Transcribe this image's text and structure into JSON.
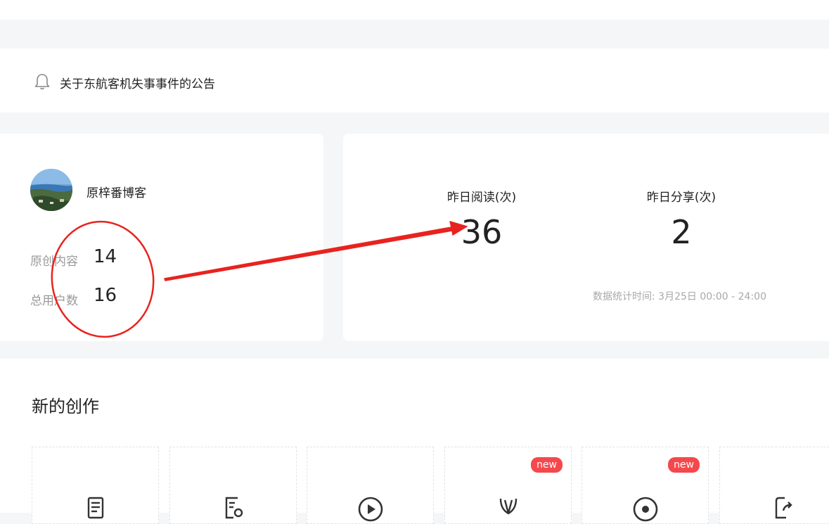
{
  "notice": {
    "text": "关于东航客机失事事件的公告",
    "icon": "bell-icon"
  },
  "profile": {
    "name": "原梓番博客",
    "stats": [
      {
        "label": "原创内容",
        "value": "14"
      },
      {
        "label": "总用户数",
        "value": "16"
      }
    ]
  },
  "yesterday": {
    "reads_label": "昨日阅读(次)",
    "reads_value": "36",
    "shares_label": "昨日分享(次)",
    "shares_value": "2",
    "stat_time": "数据统计时间: 3月25日 00:00 - 24:00"
  },
  "create": {
    "title": "新的创作",
    "tools": [
      {
        "icon": "article-icon",
        "badge": ""
      },
      {
        "icon": "doc-edit-icon",
        "badge": ""
      },
      {
        "icon": "play-icon",
        "badge": ""
      },
      {
        "icon": "tag-icon",
        "badge": "new"
      },
      {
        "icon": "record-icon",
        "badge": "new"
      },
      {
        "icon": "share-doc-icon",
        "badge": ""
      }
    ]
  },
  "colors": {
    "annotation": "#e8231f",
    "badge": "#f5484c"
  }
}
